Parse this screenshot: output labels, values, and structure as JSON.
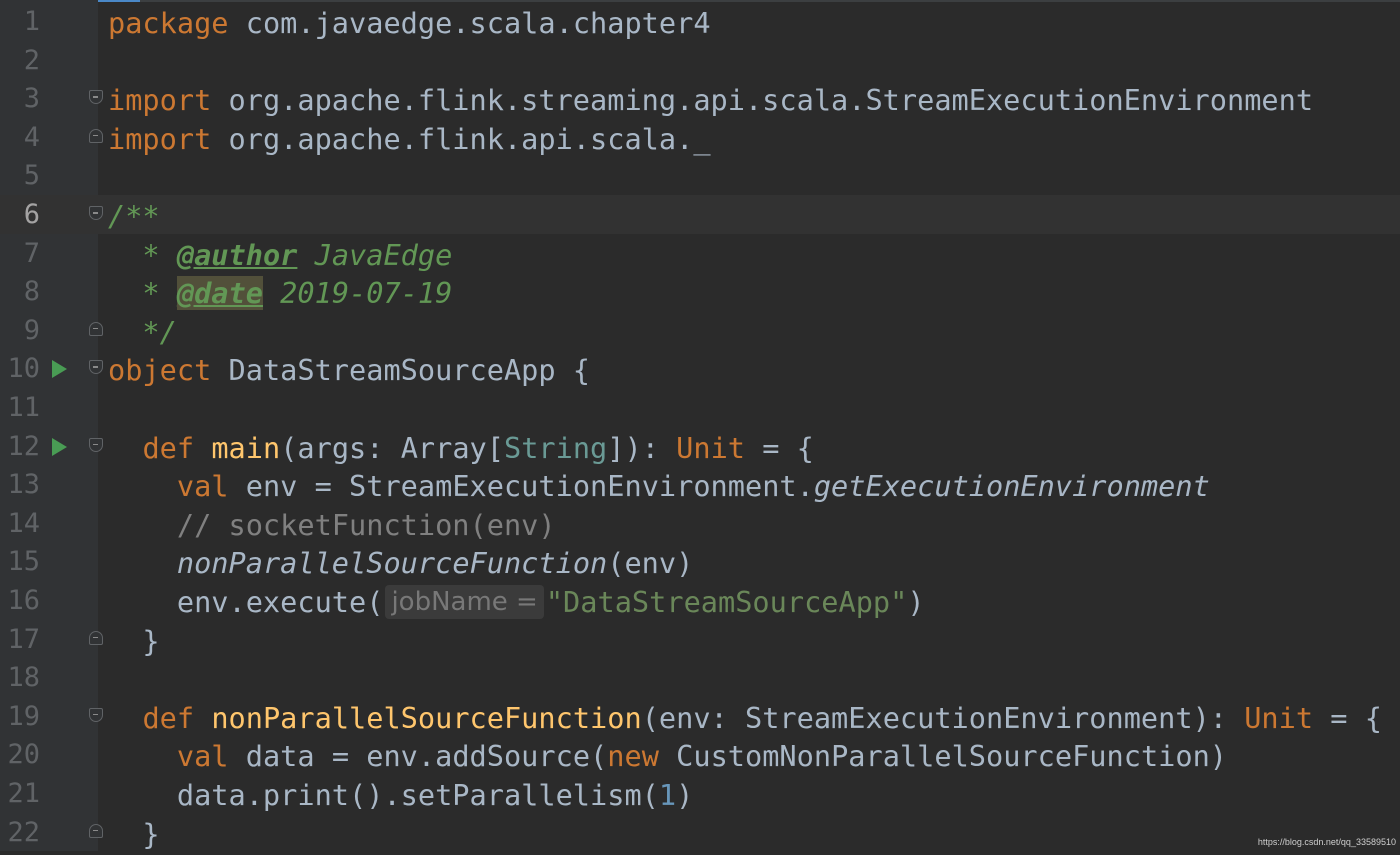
{
  "editor": {
    "lines": [
      {
        "num": "1",
        "tokens": [
          [
            "kw",
            "package"
          ],
          [
            "p",
            " com.javaedge.scala.chapter4"
          ]
        ]
      },
      {
        "num": "2",
        "tokens": []
      },
      {
        "num": "3",
        "fold": "open",
        "tokens": [
          [
            "kw",
            "import"
          ],
          [
            "p",
            " org.apache.flink.streaming.api.scala.StreamExecutionEnvironment"
          ]
        ]
      },
      {
        "num": "4",
        "fold": "close",
        "tokens": [
          [
            "kw",
            "import"
          ],
          [
            "p",
            " org.apache.flink.api.scala._"
          ]
        ]
      },
      {
        "num": "5",
        "tokens": []
      },
      {
        "num": "6",
        "fold": "open",
        "current": true,
        "tokens": [
          [
            "doc",
            "/**"
          ]
        ]
      },
      {
        "num": "7",
        "tokens": [
          [
            "doc",
            "  * "
          ],
          [
            "doctag",
            "@author"
          ],
          [
            "doc",
            " JavaEdge"
          ]
        ]
      },
      {
        "num": "8",
        "tokens": [
          [
            "doc",
            "  * "
          ],
          [
            "doctaghl",
            "@date"
          ],
          [
            "doc",
            " 2019-07-19"
          ]
        ]
      },
      {
        "num": "9",
        "fold": "close",
        "tokens": [
          [
            "doc",
            "  */"
          ]
        ]
      },
      {
        "num": "10",
        "run": true,
        "fold": "open",
        "tokens": [
          [
            "kw",
            "object"
          ],
          [
            "p",
            " DataStreamSourceApp {"
          ]
        ]
      },
      {
        "num": "11",
        "tokens": []
      },
      {
        "num": "12",
        "run": true,
        "fold": "open",
        "tokens": [
          [
            "p",
            "  "
          ],
          [
            "kw",
            "def"
          ],
          [
            "p",
            " "
          ],
          [
            "fn",
            "main"
          ],
          [
            "p",
            "(args: Array["
          ],
          [
            "tparam",
            "String"
          ],
          [
            "p",
            "]): "
          ],
          [
            "kw",
            "Unit"
          ],
          [
            "p",
            " = {"
          ]
        ]
      },
      {
        "num": "13",
        "tokens": [
          [
            "p",
            "    "
          ],
          [
            "kw",
            "val"
          ],
          [
            "p",
            " env = StreamExecutionEnvironment."
          ],
          [
            "ital",
            "getExecutionEnvironment"
          ]
        ]
      },
      {
        "num": "14",
        "tokens": [
          [
            "cmt",
            "    // socketFunction(env)"
          ]
        ]
      },
      {
        "num": "15",
        "tokens": [
          [
            "p",
            "    "
          ],
          [
            "ital",
            "nonParallelSourceFunction"
          ],
          [
            "p",
            "(env)"
          ]
        ]
      },
      {
        "num": "16",
        "tokens": [
          [
            "p",
            "    env.execute("
          ],
          [
            "hint",
            "jobName ="
          ],
          [
            "str",
            "\"DataStreamSourceApp\""
          ],
          [
            "p",
            ")"
          ]
        ]
      },
      {
        "num": "17",
        "fold": "close",
        "tokens": [
          [
            "p",
            "  }"
          ]
        ]
      },
      {
        "num": "18",
        "tokens": []
      },
      {
        "num": "19",
        "fold": "open",
        "tokens": [
          [
            "p",
            "  "
          ],
          [
            "kw",
            "def"
          ],
          [
            "p",
            " "
          ],
          [
            "fn",
            "nonParallelSourceFunction"
          ],
          [
            "p",
            "(env: StreamExecutionEnvironment): "
          ],
          [
            "kw",
            "Unit"
          ],
          [
            "p",
            " = {"
          ]
        ]
      },
      {
        "num": "20",
        "tokens": [
          [
            "p",
            "    "
          ],
          [
            "kw",
            "val"
          ],
          [
            "p",
            " data = env.addSource("
          ],
          [
            "kw",
            "new"
          ],
          [
            "p",
            " CustomNonParallelSourceFunction)"
          ]
        ]
      },
      {
        "num": "21",
        "tokens": [
          [
            "p",
            "    data.print().setParallelism("
          ],
          [
            "num",
            "1"
          ],
          [
            "p",
            ")"
          ]
        ]
      },
      {
        "num": "22",
        "fold": "close",
        "tokens": [
          [
            "p",
            "  }"
          ]
        ]
      }
    ]
  },
  "watermark": "https://blog.csdn.net/qq_33589510"
}
